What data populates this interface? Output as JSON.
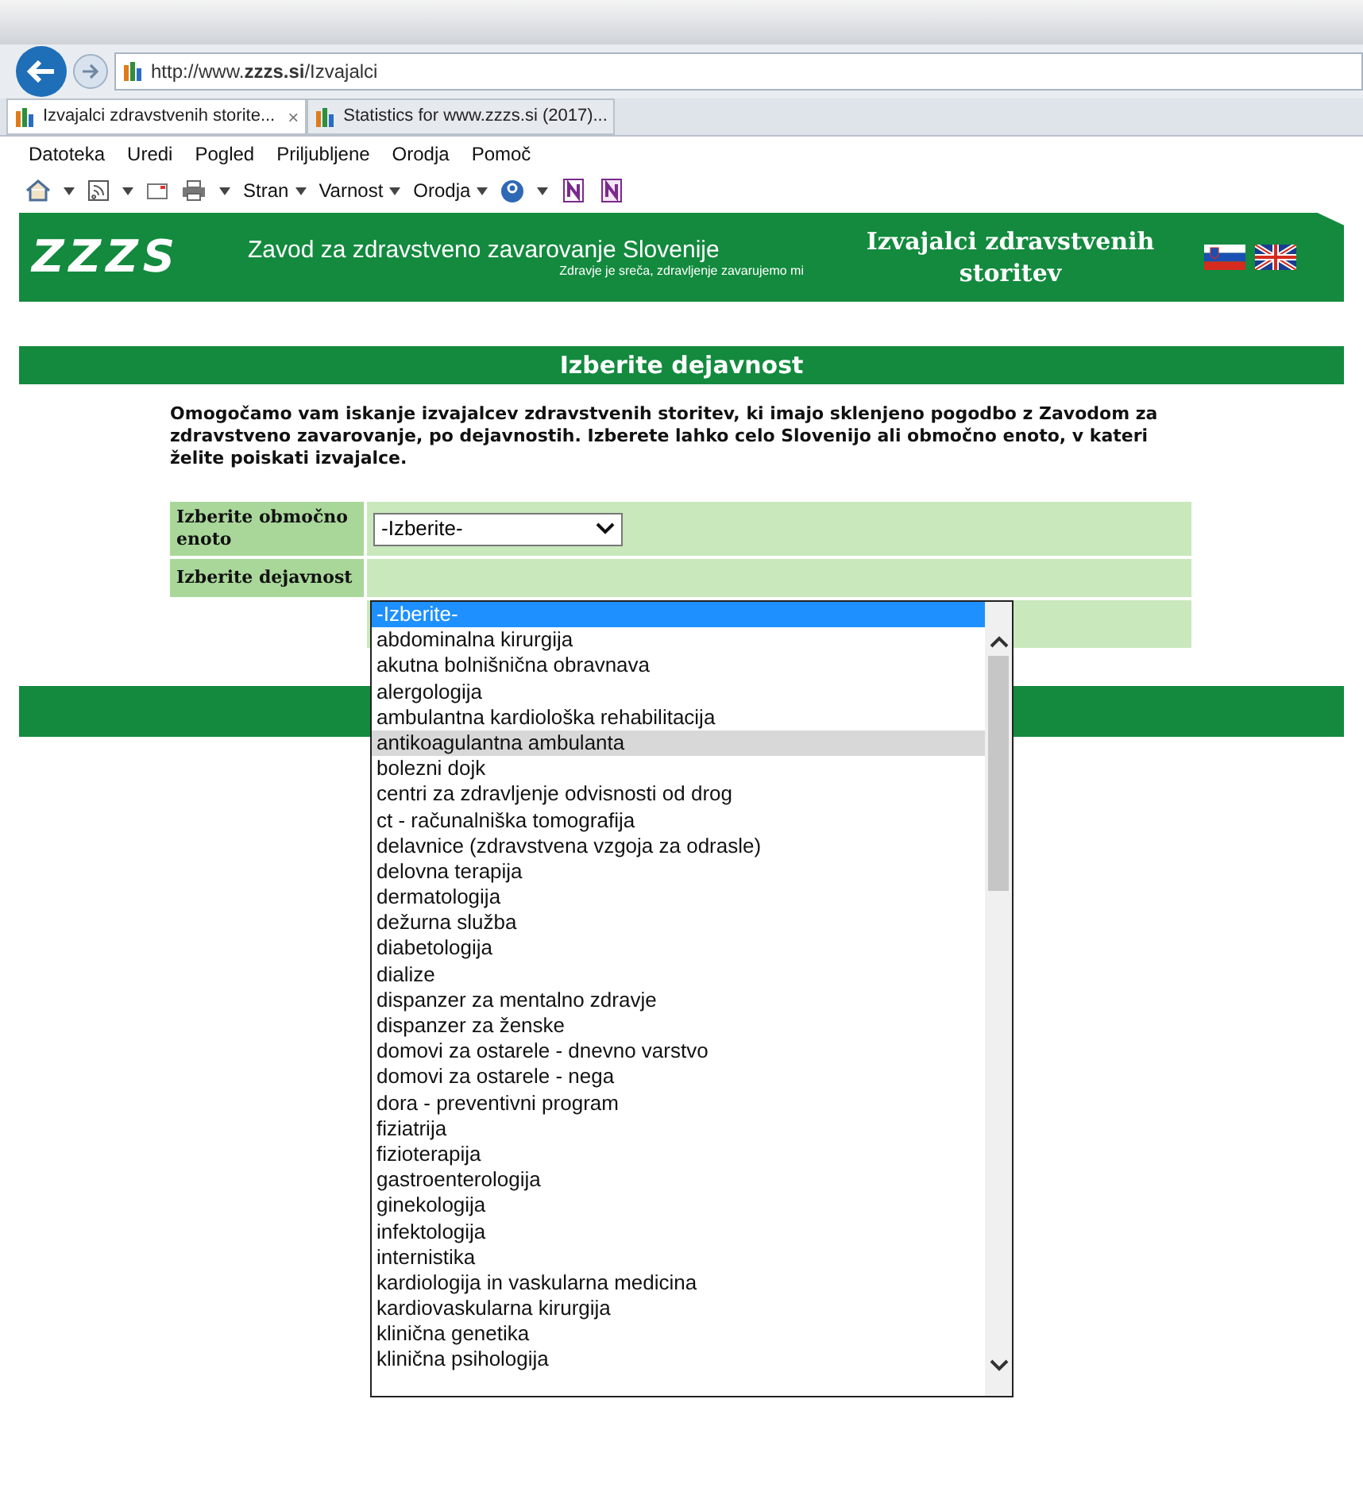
{
  "browser": {
    "address": "http://www.**zzzs.si**/Izvajalci",
    "tabs": [
      {
        "title": "Izvajalci zdravstvenih storite...",
        "selected": true,
        "close": "×"
      },
      {
        "title": "Statistics for www.zzzs.si (2017)...",
        "selected": false
      }
    ],
    "menu": [
      "Datoteka",
      "Uredi",
      "Pogled",
      "Priljubljene",
      "Orodja",
      "Pomoč"
    ],
    "toolbar": [
      "Stran",
      "Varnost",
      "Orodja"
    ]
  },
  "header": {
    "logo": "ZZZS",
    "org": "Zavod za zdravstveno zavarovanje Slovenije",
    "slogan": "Zdravje je sreča, zdravljenje zavarujemo mi",
    "section": "Izvajalci zdravstvenih storitev"
  },
  "form": {
    "title": "Izberite dejavnost",
    "intro": "Omogočamo vam iskanje izvajalcev zdravstvenih storitev, ki imajo sklenjeno pogodbo z Zavodom za zdravstveno zavarovanje, po dejavnostih. Izberete lahko celo Slovenijo ali območno enoto, v kateri želite poiskati izvajalce.",
    "fields": [
      {
        "label": "Izberite območno enoto",
        "kind": "select",
        "value": "-Izberite-"
      },
      {
        "label": "Izberite dejavnost",
        "kind": "listbox"
      }
    ],
    "options": [
      {
        "text": "-Izberite-",
        "selected": true,
        "hovered": false
      },
      {
        "text": "abdominalna kirurgija",
        "selected": false,
        "hovered": false
      },
      {
        "text": "akutna bolnišnična obravnava",
        "selected": false,
        "hovered": false
      },
      {
        "text": "alergologija",
        "selected": false,
        "hovered": false
      },
      {
        "text": "ambulantna kardiološka rehabilitacija",
        "selected": false,
        "hovered": false
      },
      {
        "text": "antikoagulantna ambulanta",
        "selected": false,
        "hovered": true
      },
      {
        "text": "bolezni dojk",
        "selected": false,
        "hovered": false
      },
      {
        "text": "centri za zdravljenje odvisnosti od drog",
        "selected": false,
        "hovered": false
      },
      {
        "text": "ct - računalniška tomografija",
        "selected": false,
        "hovered": false
      },
      {
        "text": "delavnice (zdravstvena vzgoja za odrasle)",
        "selected": false,
        "hovered": false
      },
      {
        "text": "delovna terapija",
        "selected": false,
        "hovered": false
      },
      {
        "text": "dermatologija",
        "selected": false,
        "hovered": false
      },
      {
        "text": "dežurna služba",
        "selected": false,
        "hovered": false
      },
      {
        "text": "diabetologija",
        "selected": false,
        "hovered": false
      },
      {
        "text": "dialize",
        "selected": false,
        "hovered": false
      },
      {
        "text": "dispanzer za mentalno zdravje",
        "selected": false,
        "hovered": false
      },
      {
        "text": "dispanzer za ženske",
        "selected": false,
        "hovered": false
      },
      {
        "text": "domovi za ostarele - dnevno varstvo",
        "selected": false,
        "hovered": false
      },
      {
        "text": "domovi za ostarele - nega",
        "selected": false,
        "hovered": false
      },
      {
        "text": "dora - preventivni program",
        "selected": false,
        "hovered": false
      },
      {
        "text": "fiziatrija",
        "selected": false,
        "hovered": false
      },
      {
        "text": "fizioterapija",
        "selected": false,
        "hovered": false
      },
      {
        "text": "gastroenterologija",
        "selected": false,
        "hovered": false
      },
      {
        "text": "ginekologija",
        "selected": false,
        "hovered": false
      },
      {
        "text": "infektologija",
        "selected": false,
        "hovered": false
      },
      {
        "text": "internistika",
        "selected": false,
        "hovered": false
      },
      {
        "text": "kardiologija in vaskularna medicina",
        "selected": false,
        "hovered": false
      },
      {
        "text": "kardiovaskularna kirurgija",
        "selected": false,
        "hovered": false
      },
      {
        "text": "klinična genetika",
        "selected": false,
        "hovered": false
      },
      {
        "text": "klinična psihologija",
        "selected": false,
        "hovered": false
      }
    ]
  }
}
